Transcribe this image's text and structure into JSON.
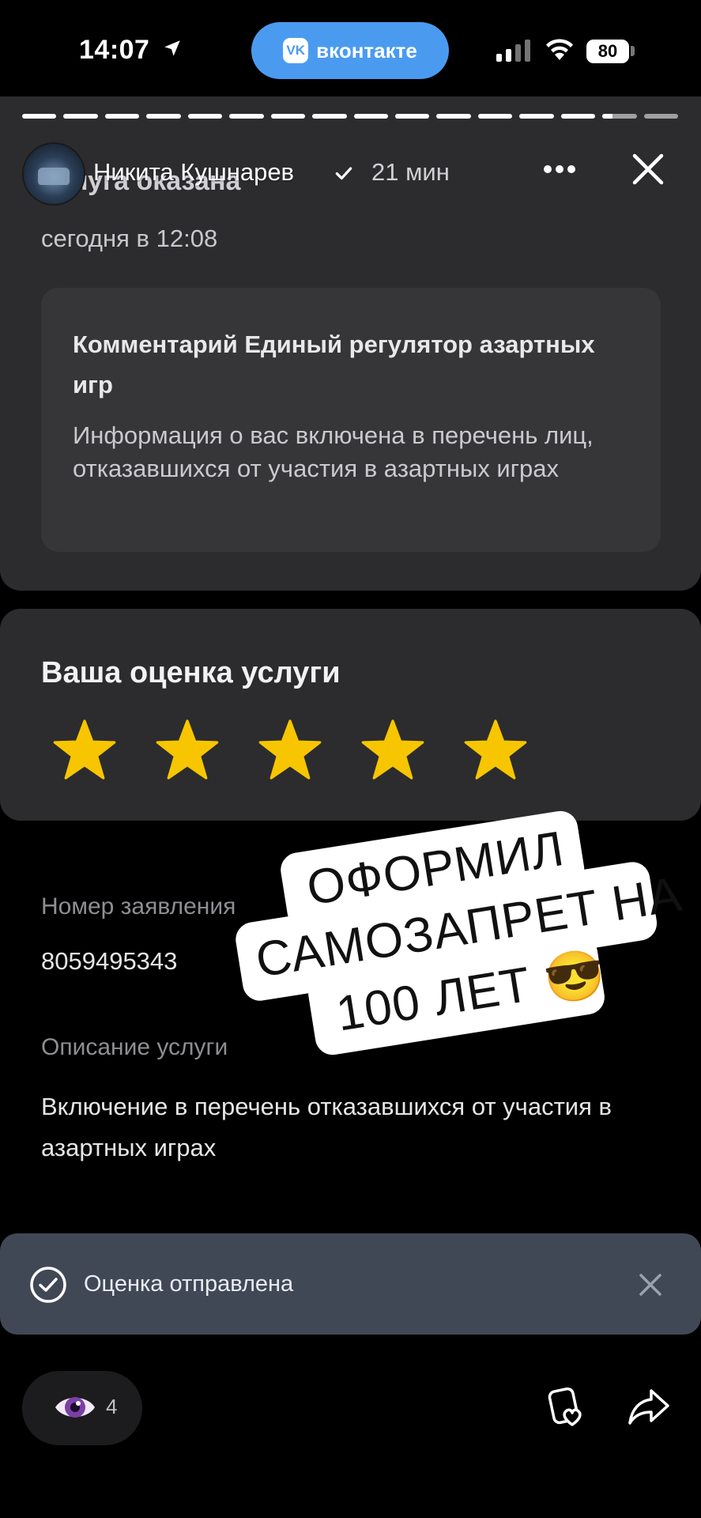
{
  "status_bar": {
    "time": "14:07",
    "app_pill": "вконтакте",
    "app_logo": "vk",
    "battery": "80"
  },
  "story": {
    "author": "Никита Кушнарев",
    "age": "21 мин",
    "progress": {
      "segments": 16,
      "current_index": 14,
      "current_fraction": 0.3
    }
  },
  "service_card": {
    "title_partial": "Услуга оказана",
    "date": "сегодня в 12:08",
    "comment_title": "Комментарий Единый регулятор азартных игр",
    "comment_body": "Информация о вас включена в перечень лиц, отказавшихся от участия в азартных играх"
  },
  "rating": {
    "title": "Ваша оценка услуги",
    "stars_filled": 5,
    "stars_total": 5,
    "star_color": "#f7c600"
  },
  "details": {
    "number_label": "Номер заявления",
    "number_value": "8059495343",
    "description_label": "Описание услуги",
    "description_value": "Включение в перечень отказавшихся от участия в азартных играх"
  },
  "sticker": {
    "line1": "ОФОРМИЛ",
    "line2": "САМОЗАПРЕТ НА",
    "line3": "100 ЛЕТ 😎"
  },
  "toast": {
    "text": "Оценка отправлена"
  },
  "bottom": {
    "views": "4"
  },
  "colors": {
    "vk_blue": "#4a9bf0",
    "card_bg": "#2c2c2e",
    "toast_bg": "#404856"
  }
}
